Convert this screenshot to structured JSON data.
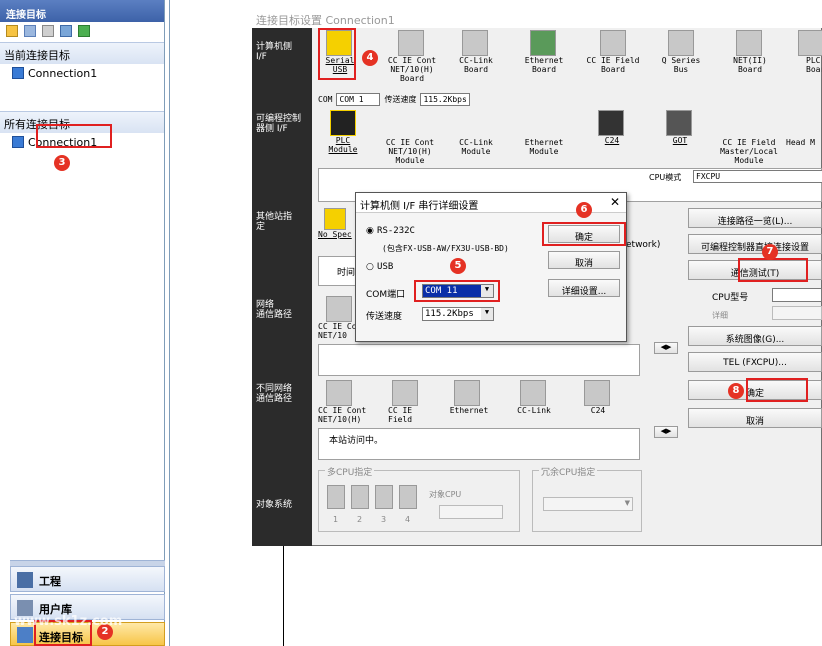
{
  "nav": {
    "header": "连接目标",
    "current_section": "当前连接目标",
    "current_item": "Connection1",
    "all_section": "所有连接目标",
    "all_item": "Connection1",
    "bottom": {
      "project": "工程",
      "userlib": "用户库",
      "target": "连接目标"
    },
    "watermark": "www.sk1z.com"
  },
  "dialog": {
    "title": "连接目标设置 Connection1",
    "side": {
      "pc_if": "计算机侧\nI/F",
      "plc_if": "可编程控制\n器侧 I/F",
      "other_station": "其他站指\n定",
      "network_route": "网络\n通信路径",
      "diff_network": "不同网络\n通信路径",
      "target_system": "对象系统"
    },
    "pc_icons": [
      {
        "label": "Serial\nUSB"
      },
      {
        "label": "CC IE Cont\nNET/10(H)\nBoard"
      },
      {
        "label": "CC-Link\nBoard"
      },
      {
        "label": "Ethernet\nBoard"
      },
      {
        "label": "CC IE Field\nBoard"
      },
      {
        "label": "Q Series\nBus"
      },
      {
        "label": "NET(II)\nBoard"
      },
      {
        "label": "PLC\nBoard"
      }
    ],
    "com_line": {
      "com_label": "COM",
      "com_value": "COM 1",
      "speed_label": "传送速度",
      "speed_value": "115.2Kbps"
    },
    "plc_icons": [
      {
        "label": "PLC\nModule"
      },
      {
        "label": "CC IE Cont\nNET/10(H)\nModule"
      },
      {
        "label": "CC-Link\nModule"
      },
      {
        "label": "Ethernet\nModule"
      },
      {
        "label": "C24"
      },
      {
        "label": "GOT"
      },
      {
        "label": "CC IE Field\nMaster/Local\nModule"
      },
      {
        "label": "Head M"
      }
    ],
    "cpu_mode_label": "CPU模式",
    "cpu_mode_value": "FXCPU",
    "no_spec": "No Spec",
    "time_label": "时间",
    "network_text": "etwork)",
    "route_icon_label": "CC IE Co\nNET/10",
    "diff_icons": [
      {
        "label": "CC IE Cont\nNET/10(H)"
      },
      {
        "label": "CC IE\nField"
      },
      {
        "label": "Ethernet"
      },
      {
        "label": "CC-Link"
      },
      {
        "label": "C24"
      }
    ],
    "local_access": "本站访问中。",
    "multi_cpu": {
      "title": "多CPU指定",
      "target_cpu": "对象CPU",
      "nums": [
        "1",
        "2",
        "3",
        "4"
      ]
    },
    "redundant_cpu": {
      "title": "冗余CPU指定"
    },
    "right_buttons": {
      "route_list": "连接路径一览(L)...",
      "direct": "可编程控制器直接连接设置",
      "comm_test": "通信测试(T)",
      "cpu_type": "CPU型号",
      "detail": "详细",
      "sys_image": "系统图像(G)...",
      "tel": "TEL (FXCPU)...",
      "ok": "确定",
      "cancel": "取消"
    }
  },
  "popup": {
    "title": "计算机侧 I/F 串行详细设置",
    "rs232c": "RS-232C",
    "rs232c_note": "(包含FX-USB-AW/FX3U-USB-BD)",
    "usb": "USB",
    "com_port_label": "COM端口",
    "com_port_value": "COM 11",
    "speed_label": "传送速度",
    "speed_value": "115.2Kbps",
    "ok": "确定",
    "cancel": "取消",
    "detail": "详细设置...",
    "close": "✕"
  },
  "badges": [
    "2",
    "3",
    "4",
    "5",
    "6",
    "7",
    "8"
  ],
  "colors": {
    "badge": "#e53224",
    "highlight": "#e02020",
    "selected": "#0a2fa8"
  }
}
